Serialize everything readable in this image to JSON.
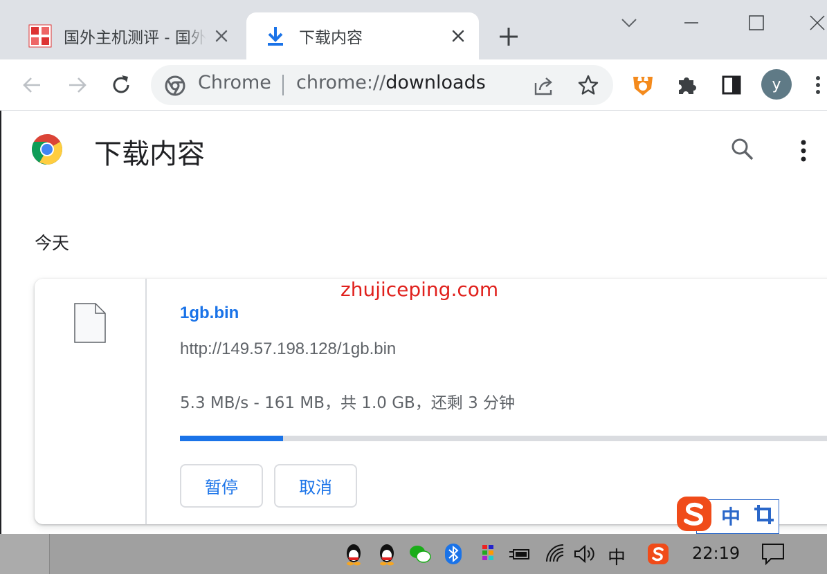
{
  "tabs": [
    {
      "title": "国外主机测评 - 国外",
      "icon": "site-favicon"
    },
    {
      "title": "下载内容",
      "icon": "download-icon"
    }
  ],
  "omnibox": {
    "chip": "Chrome",
    "url_scheme": "chrome://",
    "url_path": "downloads"
  },
  "profile": {
    "initial": "y"
  },
  "page": {
    "title": "下载内容",
    "section_date": "今天"
  },
  "download": {
    "file_name": "1gb.bin",
    "url": "http://149.57.198.128/1gb.bin",
    "status": "5.3 MB/s - 161 MB，共 1.0 GB，还剩 3 分钟",
    "progress_fraction": 0.157,
    "pause_label": "暂停",
    "cancel_label": "取消"
  },
  "watermark": "zhujiceping.com",
  "ime": {
    "mode": "中"
  },
  "taskbar": {
    "ime_indicator": "中",
    "clock": "22:19"
  },
  "colors": {
    "accent": "#1a73e8",
    "watermark": "#e0201c",
    "sogou": "#f04b19"
  }
}
